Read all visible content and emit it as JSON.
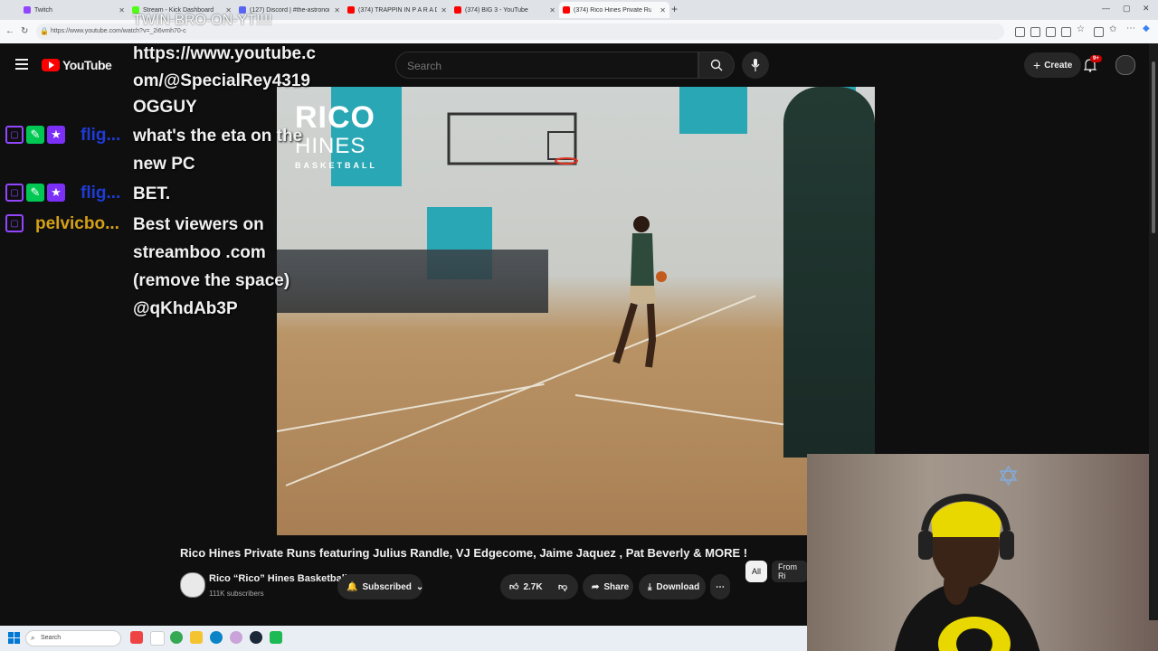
{
  "browser": {
    "tabs": [
      {
        "label": "Twitch",
        "color": "#9146ff"
      },
      {
        "label": "Stream - Kick Dashboard",
        "color": "#53fc18"
      },
      {
        "label": "(127) Discord | #the-astronomica...",
        "color": "#5865f2"
      },
      {
        "label": "(374) TRAPPIN IN P A R A D I S...",
        "color": "#ff0000"
      },
      {
        "label": "(374) BIG 3 - YouTube",
        "color": "#ff0000"
      },
      {
        "label": "(374) Rico Hines Private Run...",
        "color": "#ff0000"
      }
    ],
    "url": "https://www.youtube.com/watch?v=_2i6vmh70-c"
  },
  "stream_overlay": {
    "top_text": "TWIN-BRO-ON-YT!!!!",
    "chat": [
      {
        "text_lines": [
          "https://www.youtube.c",
          "om/@SpecialRey4319"
        ]
      },
      {
        "text_lines": [
          "OGGUY"
        ]
      },
      {
        "user": "flig...",
        "user_color": "#1f3bd6",
        "text_lines": [
          "what's the eta on the",
          "new PC"
        ]
      },
      {
        "user": "flig...",
        "user_color": "#1f3bd6",
        "text_lines": [
          "BET."
        ]
      },
      {
        "user": "pelvicbo...",
        "user_color": "#d4a017",
        "text_lines": [
          "Best viewers on",
          "streamboo .com",
          "(remove the space)",
          "@qKhdAb3P"
        ]
      }
    ]
  },
  "youtube": {
    "logo_text": "YouTube",
    "search_placeholder": "Search",
    "create_label": "Create",
    "notifications_badge": "9+",
    "video": {
      "logo_big": "RICO",
      "logo_big2": "HINES",
      "logo_small": "BASKETBALL"
    },
    "title": "Rico Hines Private Runs featuring Julius Randle, VJ Edgecome, Jaime Jaquez , Pat Beverly & MORE !",
    "channel": "Rico “Rico” Hines Basketball",
    "subscribers": "111K subscribers",
    "subscribed_label": "Subscribed",
    "likes": "2.7K",
    "share_label": "Share",
    "download_label": "Download",
    "chips": [
      "All",
      "From Ri"
    ]
  },
  "taskbar": {
    "search_placeholder": "Search"
  }
}
